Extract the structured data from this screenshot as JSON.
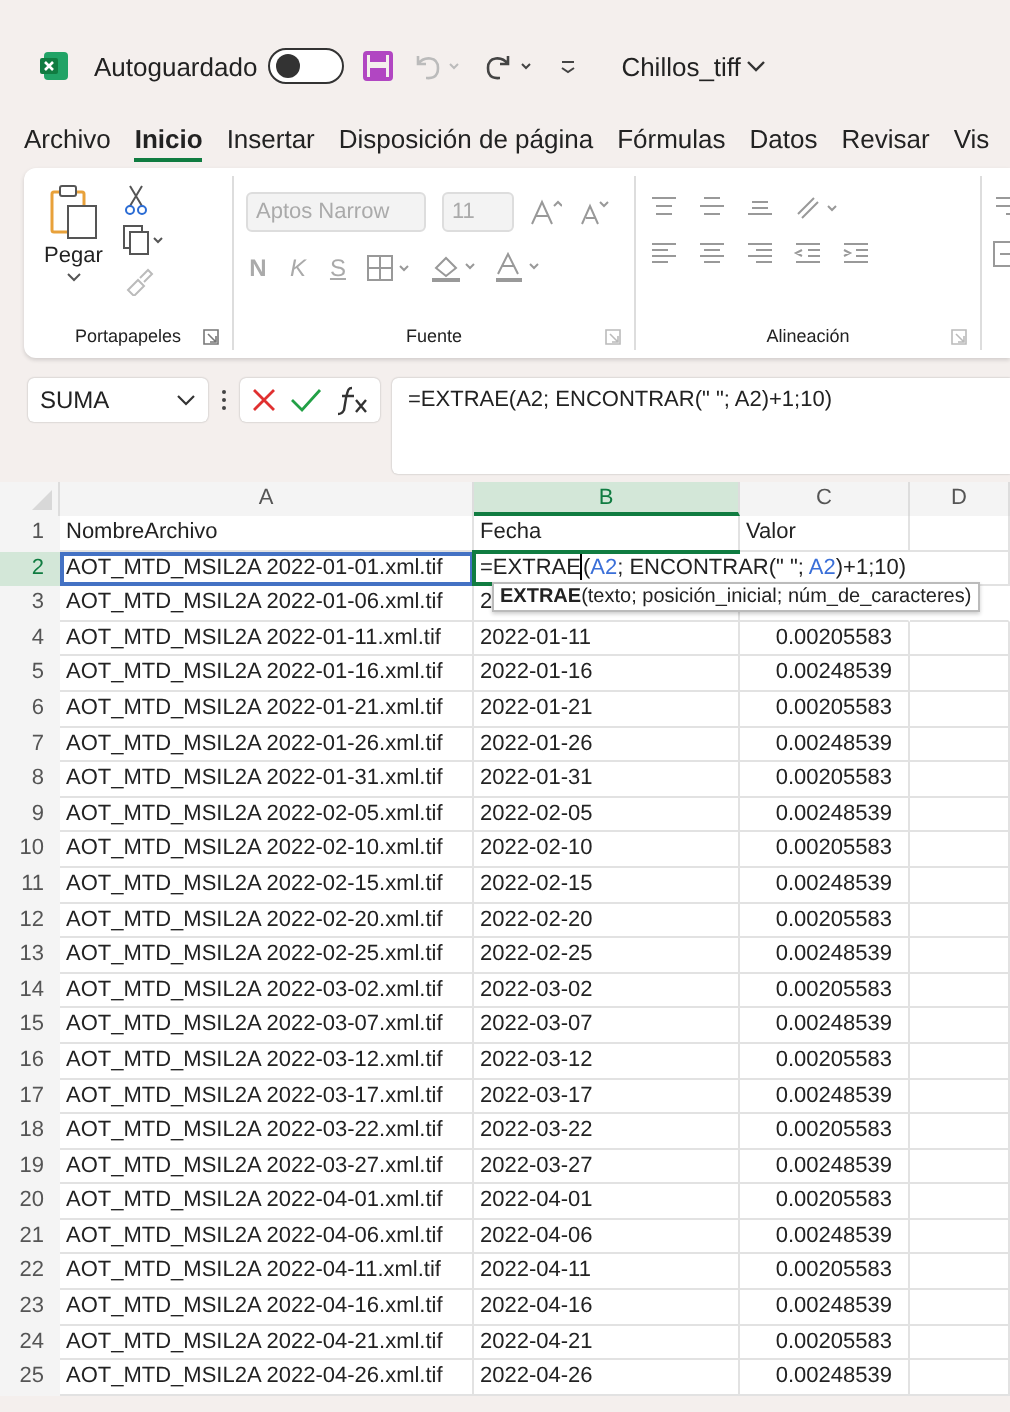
{
  "title_bar": {
    "autosave_label": "Autoguardado",
    "autosave_on": false,
    "file_name": "Chillos_tiff"
  },
  "menu_tabs": [
    {
      "label": "Archivo",
      "selected": false
    },
    {
      "label": "Inicio",
      "selected": true
    },
    {
      "label": "Insertar",
      "selected": false
    },
    {
      "label": "Disposición de página",
      "selected": false
    },
    {
      "label": "Fórmulas",
      "selected": false
    },
    {
      "label": "Datos",
      "selected": false
    },
    {
      "label": "Revisar",
      "selected": false
    },
    {
      "label": "Vis",
      "selected": false
    }
  ],
  "ribbon": {
    "clipboard": {
      "paste_label": "Pegar",
      "group_label": "Portapapeles"
    },
    "font": {
      "font_name": "Aptos Narrow",
      "font_size": "11",
      "disabled": true,
      "style_buttons": [
        "N",
        "K",
        "S"
      ],
      "group_label": "Fuente"
    },
    "alignment": {
      "group_label": "Alineación"
    }
  },
  "formula_bar": {
    "name_box": "SUMA",
    "formula": "=EXTRAE(A2; ENCONTRAR(\" \"; A2)+1;10)"
  },
  "sheet": {
    "columns": [
      {
        "label": "A",
        "selected": false
      },
      {
        "label": "B",
        "selected": true
      },
      {
        "label": "C",
        "selected": false
      },
      {
        "label": "D",
        "selected": false
      }
    ],
    "editing_cell": {
      "segments": [
        {
          "kind": "text",
          "text": "=EXTRAE"
        },
        {
          "kind": "cursor"
        },
        {
          "kind": "text",
          "text": "("
        },
        {
          "kind": "ref",
          "text": "A2"
        },
        {
          "kind": "text",
          "text": "; ENCONTRAR(\" \"; "
        },
        {
          "kind": "ref",
          "text": "A2"
        },
        {
          "kind": "text",
          "text": ")+1;10)"
        }
      ]
    },
    "tooltip": "**EXTRAE**(texto; posición_inicial; núm_de_caracteres)",
    "rows": [
      {
        "number": "1",
        "selected": false,
        "cells": [
          "NombreArchivo",
          "Fecha",
          "Valor"
        ]
      },
      {
        "number": "2",
        "selected": true,
        "cells": [
          "AOT_MTD_MSIL2A 2022-01-01.xml.tif"
        ]
      },
      {
        "number": "3",
        "selected": false,
        "cells": [
          "AOT_MTD_MSIL2A 2022-01-06.xml.tif",
          "2"
        ]
      },
      {
        "number": "4",
        "selected": false,
        "cells": [
          "AOT_MTD_MSIL2A 2022-01-11.xml.tif",
          "2022-01-11",
          "0.00205583"
        ]
      },
      {
        "number": "5",
        "selected": false,
        "cells": [
          "AOT_MTD_MSIL2A 2022-01-16.xml.tif",
          "2022-01-16",
          "0.00248539"
        ]
      },
      {
        "number": "6",
        "selected": false,
        "cells": [
          "AOT_MTD_MSIL2A 2022-01-21.xml.tif",
          "2022-01-21",
          "0.00205583"
        ]
      },
      {
        "number": "7",
        "selected": false,
        "cells": [
          "AOT_MTD_MSIL2A 2022-01-26.xml.tif",
          "2022-01-26",
          "0.00248539"
        ]
      },
      {
        "number": "8",
        "selected": false,
        "cells": [
          "AOT_MTD_MSIL2A 2022-01-31.xml.tif",
          "2022-01-31",
          "0.00205583"
        ]
      },
      {
        "number": "9",
        "selected": false,
        "cells": [
          "AOT_MTD_MSIL2A 2022-02-05.xml.tif",
          "2022-02-05",
          "0.00248539"
        ]
      },
      {
        "number": "10",
        "selected": false,
        "cells": [
          "AOT_MTD_MSIL2A 2022-02-10.xml.tif",
          "2022-02-10",
          "0.00205583"
        ]
      },
      {
        "number": "11",
        "selected": false,
        "cells": [
          "AOT_MTD_MSIL2A 2022-02-15.xml.tif",
          "2022-02-15",
          "0.00248539"
        ]
      },
      {
        "number": "12",
        "selected": false,
        "cells": [
          "AOT_MTD_MSIL2A 2022-02-20.xml.tif",
          "2022-02-20",
          "0.00205583"
        ]
      },
      {
        "number": "13",
        "selected": false,
        "cells": [
          "AOT_MTD_MSIL2A 2022-02-25.xml.tif",
          "2022-02-25",
          "0.00248539"
        ]
      },
      {
        "number": "14",
        "selected": false,
        "cells": [
          "AOT_MTD_MSIL2A 2022-03-02.xml.tif",
          "2022-03-02",
          "0.00205583"
        ]
      },
      {
        "number": "15",
        "selected": false,
        "cells": [
          "AOT_MTD_MSIL2A 2022-03-07.xml.tif",
          "2022-03-07",
          "0.00248539"
        ]
      },
      {
        "number": "16",
        "selected": false,
        "cells": [
          "AOT_MTD_MSIL2A 2022-03-12.xml.tif",
          "2022-03-12",
          "0.00205583"
        ]
      },
      {
        "number": "17",
        "selected": false,
        "cells": [
          "AOT_MTD_MSIL2A 2022-03-17.xml.tif",
          "2022-03-17",
          "0.00248539"
        ]
      },
      {
        "number": "18",
        "selected": false,
        "cells": [
          "AOT_MTD_MSIL2A 2022-03-22.xml.tif",
          "2022-03-22",
          "0.00205583"
        ]
      },
      {
        "number": "19",
        "selected": false,
        "cells": [
          "AOT_MTD_MSIL2A 2022-03-27.xml.tif",
          "2022-03-27",
          "0.00248539"
        ]
      },
      {
        "number": "20",
        "selected": false,
        "cells": [
          "AOT_MTD_MSIL2A 2022-04-01.xml.tif",
          "2022-04-01",
          "0.00205583"
        ]
      },
      {
        "number": "21",
        "selected": false,
        "cells": [
          "AOT_MTD_MSIL2A 2022-04-06.xml.tif",
          "2022-04-06",
          "0.00248539"
        ]
      },
      {
        "number": "22",
        "selected": false,
        "cells": [
          "AOT_MTD_MSIL2A 2022-04-11.xml.tif",
          "2022-04-11",
          "0.00205583"
        ]
      },
      {
        "number": "23",
        "selected": false,
        "cells": [
          "AOT_MTD_MSIL2A 2022-04-16.xml.tif",
          "2022-04-16",
          "0.00248539"
        ]
      },
      {
        "number": "24",
        "selected": false,
        "cells": [
          "AOT_MTD_MSIL2A 2022-04-21.xml.tif",
          "2022-04-21",
          "0.00205583"
        ]
      },
      {
        "number": "25",
        "selected": false,
        "cells": [
          "AOT_MTD_MSIL2A 2022-04-26.xml.tif",
          "2022-04-26",
          "0.00248539"
        ]
      }
    ]
  }
}
